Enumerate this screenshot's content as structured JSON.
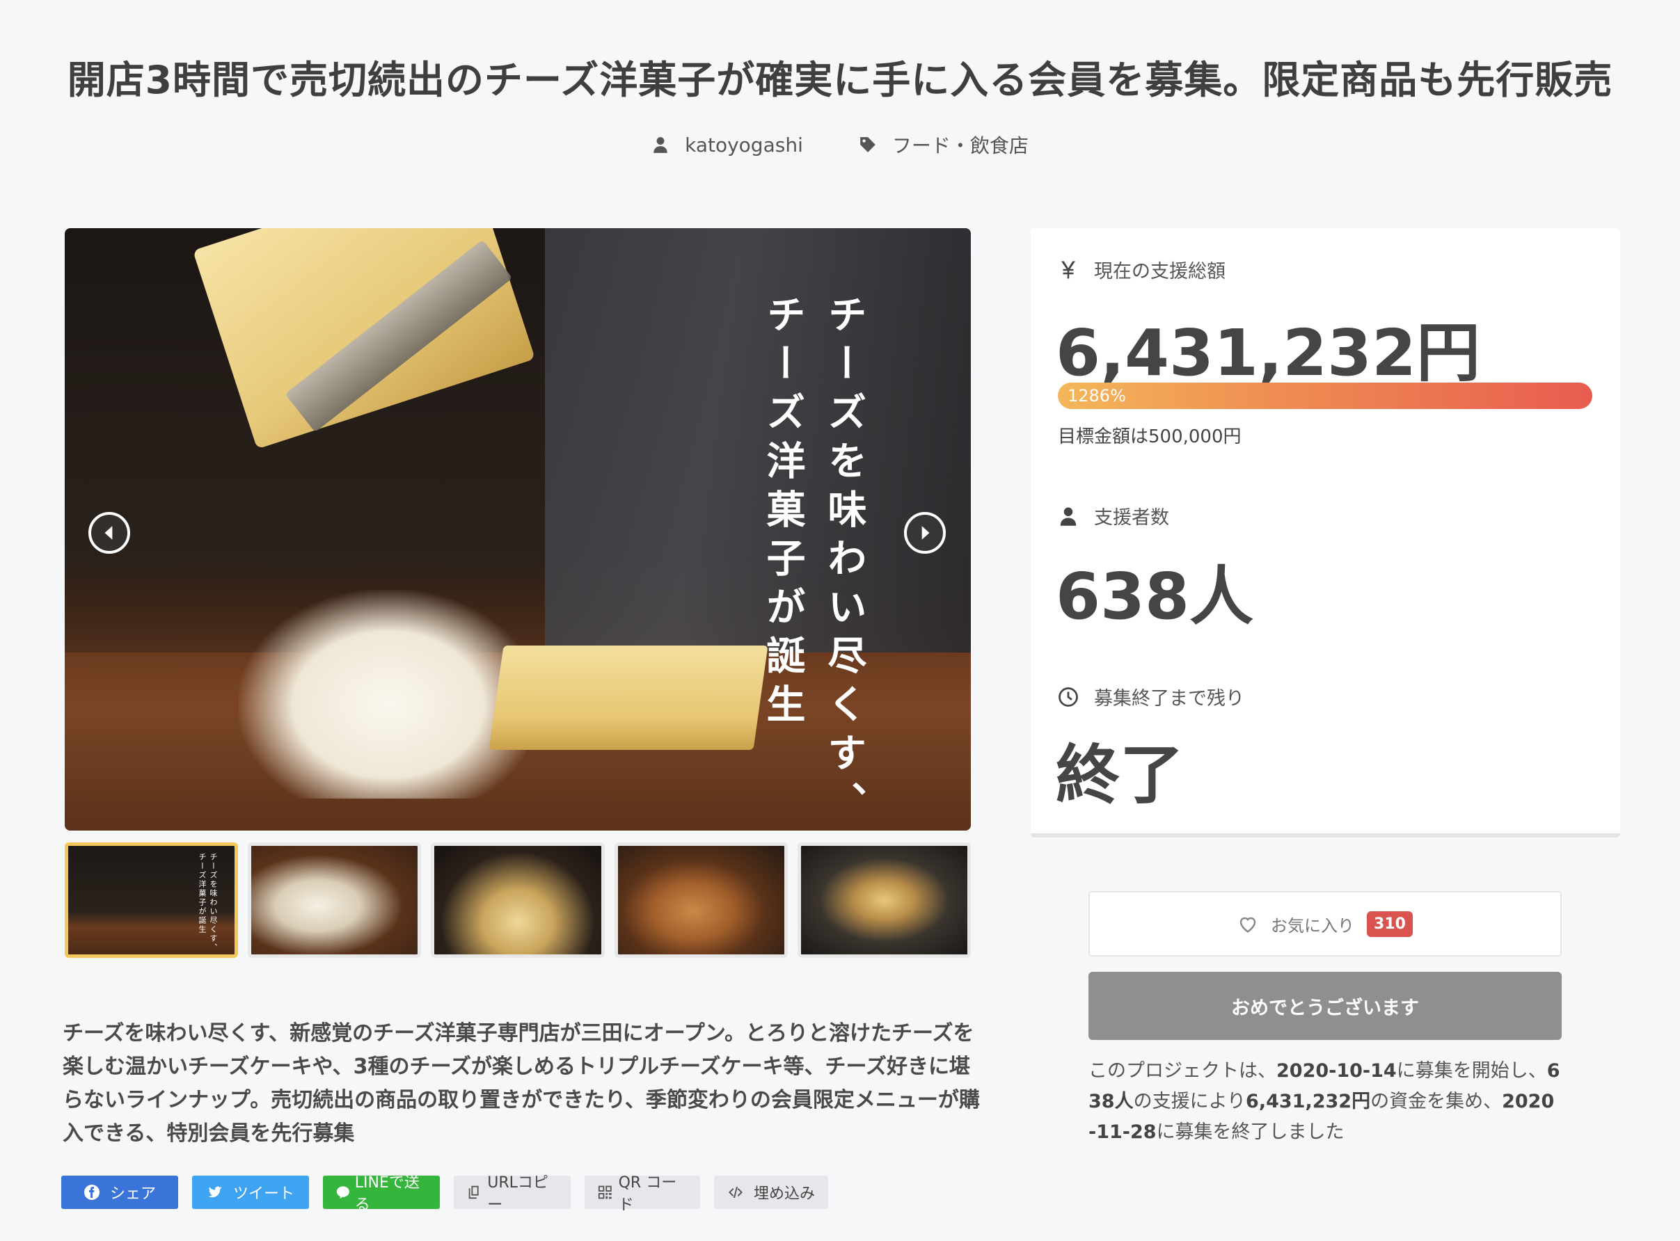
{
  "project": {
    "title": "開店3時間で売切続出のチーズ洋菓子が確実に手に入る会員を募集。限定商品も先行販売",
    "author": "katoyogashi",
    "category": "フード・飲食店"
  },
  "hero": {
    "overlay_line1": "チーズを味わい尽くす、",
    "overlay_line2": "チーズ洋菓子が誕生",
    "thumbnail_overlay_line1": "チーズを味わい尽くす、",
    "thumbnail_overlay_line2": "チーズ洋菓子が誕生"
  },
  "description": "チーズを味わい尽くす、新感覚のチーズ洋菓子専門店が三田にオープン。とろりと溶けたチーズを楽しむ温かいチーズケーキや、3種のチーズが楽しめるトリプルチーズケーキ等、チーズ好きに堪らないラインナップ。売切続出の商品の取り置きができたり、季節変わりの会員限定メニューが購入できる、特別会員を先行募集",
  "share": {
    "facebook": "シェア",
    "twitter": "ツイート",
    "line": "LINEで送る",
    "url_copy": "URLコピー",
    "qr": "QR コード",
    "embed": "埋め込み"
  },
  "stats": {
    "amount_label": "現在の支援総額",
    "amount_value": "6,431,232円",
    "progress_text": "1286%",
    "progress_percent": 1286,
    "goal_text": "目標金額は500,000円",
    "supporters_label": "支援者数",
    "supporters_value": "638人",
    "remaining_label": "募集終了まで残り",
    "remaining_value": "終了"
  },
  "actions": {
    "favorite_label": "お気に入り",
    "favorite_count": "310",
    "status_button": "おめでとうございます"
  },
  "summary": {
    "p1": "このプロジェクトは、",
    "start_date": "2020-10-14",
    "p2": "に募集を開始し、",
    "supporters": "638人",
    "p3": "の支援により",
    "amount": "6,431,232円",
    "p4": "の資金を集め、",
    "end_date": "2020-11-28",
    "p5": "に募集を終了しました"
  }
}
